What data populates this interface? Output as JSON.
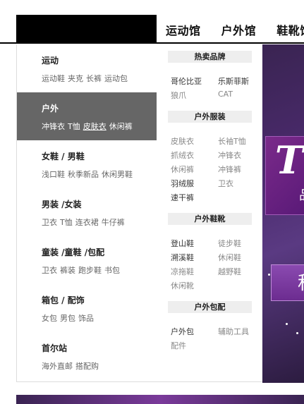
{
  "nav": {
    "items": [
      "运动馆",
      "户外馆",
      "鞋靴馆"
    ]
  },
  "categories": [
    {
      "title": "运动",
      "links": [
        "运动鞋",
        "夹克",
        "长裤",
        "运动包"
      ]
    },
    {
      "title": "户外",
      "links": [
        "冲锋衣",
        "T恤",
        "皮肤衣",
        "休闲裤"
      ],
      "active": true
    },
    {
      "title": "女鞋 / 男鞋",
      "links": [
        "浅口鞋",
        "秋季新品",
        "休闲男鞋"
      ]
    },
    {
      "title": "男装 /女装",
      "links": [
        "卫衣",
        "T恤",
        "连衣裙",
        "牛仔裤"
      ]
    },
    {
      "title": "童装 /童鞋 /包配",
      "links": [
        "卫衣",
        "裤装",
        "跑步鞋",
        "书包"
      ]
    },
    {
      "title": "箱包 / 配饰",
      "links": [
        "女包",
        "男包",
        "饰品"
      ]
    },
    {
      "title": "首尔站",
      "links": [
        "海外直邮",
        "搭配购"
      ]
    }
  ],
  "submenu": {
    "brands": {
      "title": "热卖品牌",
      "items": [
        "哥伦比亚",
        "乐斯菲斯",
        "狼爪",
        "CAT"
      ]
    },
    "apparel": {
      "title": "户外服装",
      "items": [
        "皮肤衣",
        "长袖T恤",
        "抓绒衣",
        "冲锋衣",
        "休闲裤",
        "冲锋裤",
        "羽绒服",
        "卫衣",
        "速干裤"
      ]
    },
    "footwear": {
      "title": "户外鞋靴",
      "items": [
        "登山鞋",
        "徒步鞋",
        "溯溪鞋",
        "休闲鞋",
        "凉拖鞋",
        "越野鞋",
        "休闲靴"
      ]
    },
    "bags": {
      "title": "户外包配",
      "items": [
        "户外包",
        "辅助工具",
        "配件"
      ]
    }
  },
  "banner": {
    "letter": "T",
    "sub_char": "品",
    "box_char": "秋"
  }
}
